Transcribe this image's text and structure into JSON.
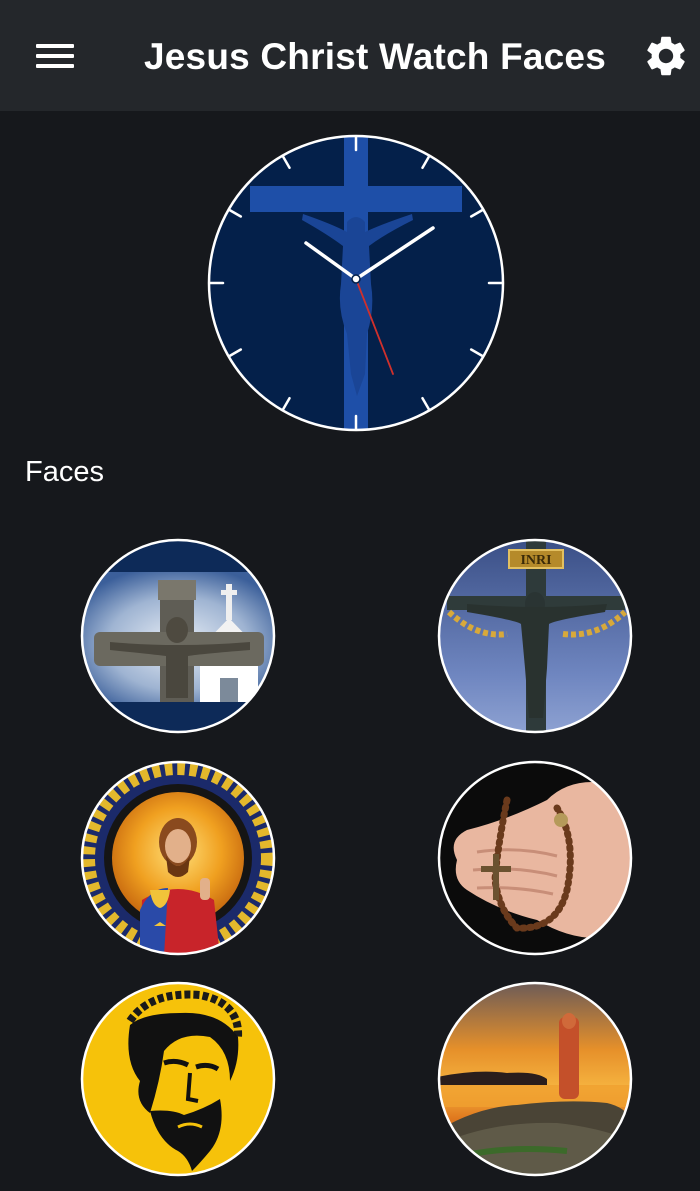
{
  "app_bar": {
    "title": "Jesus Christ Watch Faces",
    "menu_icon": "hamburger-menu-icon",
    "settings_icon": "gear-icon"
  },
  "preview": {
    "style": "analog crucifix watch face",
    "background_color": "#04204a",
    "accent_color": "#1e4fa8",
    "second_hand_color": "#d0302c"
  },
  "faces_section": {
    "label": "Faces"
  },
  "faces": [
    {
      "name": "stone crucifix with chapel"
    },
    {
      "name": "crucifix with INRI sign and sky"
    },
    {
      "name": "stained glass jesus"
    },
    {
      "name": "praying hands with rosary"
    },
    {
      "name": "jesus crown of thorns on yellow"
    },
    {
      "name": "sunset cross on rocky shore"
    }
  ],
  "inri_text": "INRI"
}
